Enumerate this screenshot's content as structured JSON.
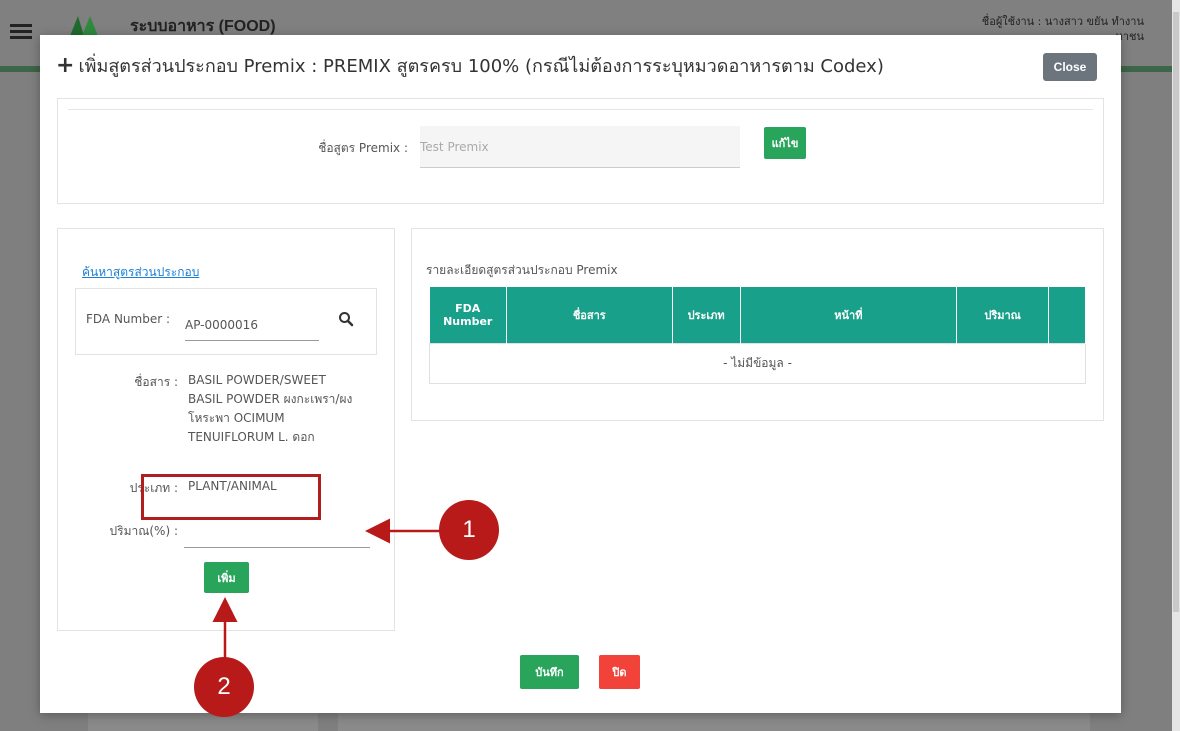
{
  "background": {
    "brand": "ระบบอาหาร (FOOD)",
    "user_line1": "ชื่อผู้ใช้งาน : นางสาว ขยัน ทำงาน",
    "user_line2": "หาชน"
  },
  "modal": {
    "title": "เพิ่มสูตรส่วนประกอบ Premix : PREMIX สูตรครบ 100% (กรณีไม่ต้องการระบุหมวดอาหารตาม Codex)",
    "close_label": "Close"
  },
  "formula": {
    "label": "ชื่อสูตร Premix :",
    "value": "Test Premix",
    "edit_label": "แก้ไข"
  },
  "search": {
    "link_label": "ค้นหาสูตรส่วนประกอบ",
    "fda_label": "FDA Number :",
    "fda_value": "AP-0000016",
    "name_label": "ชื่อสาร :",
    "name_lines": [
      "BASIL POWDER/SWEET",
      "BASIL POWDER ผงกะเพรา/ผง",
      "โหระพา OCIMUM",
      "TENUIFLORUM L. ดอก"
    ],
    "type_label": "ประเภท :",
    "type_value": "PLANT/ANIMAL",
    "qty_label": "ปริมาณ(%) :",
    "qty_value": "",
    "add_label": "เพิ่ม"
  },
  "details": {
    "title": "รายละเอียดสูตรส่วนประกอบ Premix",
    "columns": [
      "FDA Number",
      "ชื่อสาร",
      "ประเภท",
      "หน้าที่",
      "ปริมาณ",
      ""
    ],
    "empty_text": "- ไม่มีข้อมูล -"
  },
  "footer": {
    "save_label": "บันทึก",
    "close_label": "ปิด"
  },
  "annotations": {
    "badge1": "1",
    "badge2": "2",
    "color": "#b81a1a"
  },
  "colors": {
    "primary_green": "#28a45b",
    "table_header": "#19a08a",
    "danger": "#f2433a",
    "link": "#1a7fd6"
  }
}
